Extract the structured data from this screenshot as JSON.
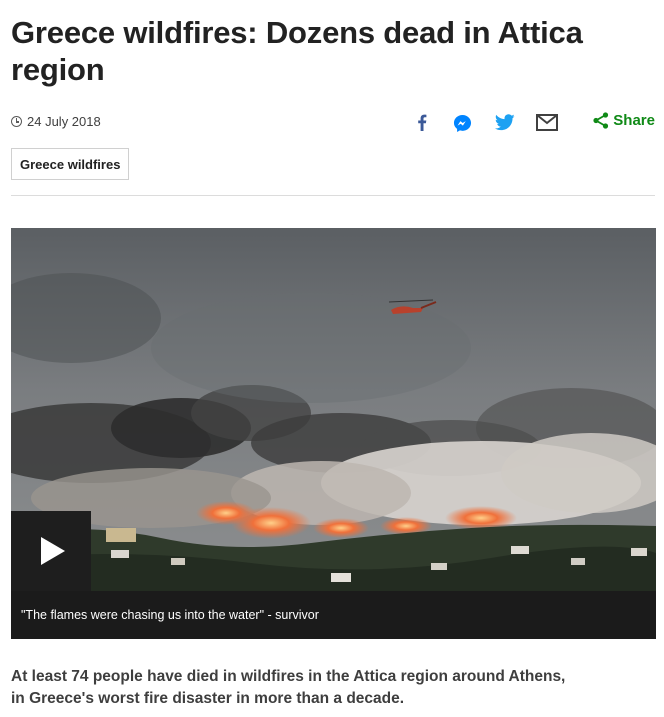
{
  "article": {
    "headline": "Greece wildfires: Dozens dead in Attica region",
    "date": "24 July 2018",
    "tag": "Greece wildfires",
    "summary_line1": "At least 74 people have died in wildfires in the Attica region around Athens,",
    "summary_line2": "in Greece's worst fire disaster in more than a decade."
  },
  "share": {
    "icons": [
      "facebook-icon",
      "messenger-icon",
      "twitter-icon",
      "email-icon"
    ],
    "label": "Share",
    "colors": {
      "facebook": "#3b5998",
      "messenger": "#0084ff",
      "twitter": "#1da1f2",
      "email": "#404040",
      "share": "#108a17"
    }
  },
  "media": {
    "caption": "\"The flames were chasing us into the water\" - survivor"
  }
}
